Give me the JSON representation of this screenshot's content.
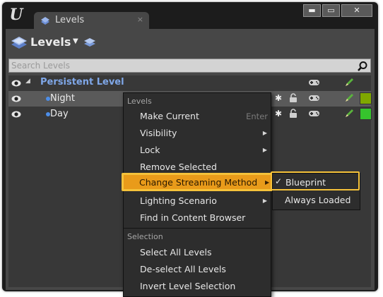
{
  "window": {
    "logo": "U",
    "tab_label": "Levels",
    "tab_close": "×",
    "buttons": {
      "minimize": "▬",
      "maximize": "▭",
      "close": "✕"
    }
  },
  "toolbar": {
    "label": "Levels",
    "dropdown_arrow": "▼"
  },
  "search": {
    "placeholder": "Search Levels"
  },
  "levels": {
    "persistent": {
      "expand_glyph": "◢",
      "name": "Persistent Level"
    },
    "rows": [
      {
        "name": "Night",
        "color": "#7fa800"
      },
      {
        "name": "Day",
        "color": "#36c42d"
      }
    ]
  },
  "context_menu": {
    "section_levels": "Levels",
    "items": [
      {
        "label": "Make Current",
        "shortcut": "Enter"
      },
      {
        "label": "Visibility",
        "submenu_arrow": "▶"
      },
      {
        "label": "Lock",
        "submenu_arrow": "▶"
      },
      {
        "label": "Remove Selected"
      },
      {
        "label": "Change Streaming Method",
        "submenu_arrow": "▶"
      },
      {
        "label": "Lighting Scenario",
        "submenu_arrow": "▶"
      },
      {
        "label": "Find in Content Browser"
      }
    ],
    "section_selection": "Selection",
    "selection_items": [
      {
        "label": "Select All Levels"
      },
      {
        "label": "De-select All Levels"
      },
      {
        "label": "Invert Level Selection"
      }
    ]
  },
  "streaming_submenu": {
    "check": "✓",
    "items": [
      "Blueprint",
      "Always Loaded"
    ]
  },
  "colors": {
    "highlight": "#f5c23a",
    "accent_blue": "#7fa7e8"
  }
}
